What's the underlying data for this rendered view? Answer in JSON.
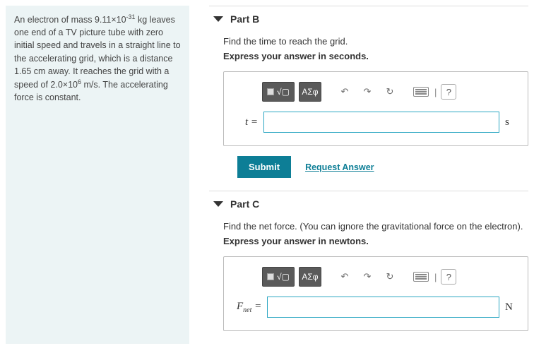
{
  "problem": {
    "html": "An electron of mass 9.11×10<sup>-31</sup> kg leaves one end of a TV picture tube with zero initial speed and travels in a straight line to the accelerating grid, which is a distance 1.65 cm away. It reaches the grid with a speed of 2.0×10<sup>6</sup> m/s. The accelerating force is constant."
  },
  "toolbar": {
    "templates_label": "▢√▢",
    "greek_label": "ΑΣφ",
    "undo_glyph": "↶",
    "redo_glyph": "↷",
    "reset_glyph": "↻",
    "keyboard_sep": "|",
    "help_glyph": "?"
  },
  "actions": {
    "submit_label": "Submit",
    "request_label": "Request Answer"
  },
  "parts": {
    "b": {
      "title": "Part B",
      "prompt": "Find the time to reach the grid.",
      "instruction": "Express your answer in seconds.",
      "var_html": "<i>t</i> =",
      "value": "",
      "unit": "s"
    },
    "c": {
      "title": "Part C",
      "prompt": "Find the net force. (You can ignore the gravitational force on the electron).",
      "instruction": "Express your answer in newtons.",
      "var_html": "<i>F</i><sub>net</sub> =",
      "value": "",
      "unit": "N"
    }
  }
}
